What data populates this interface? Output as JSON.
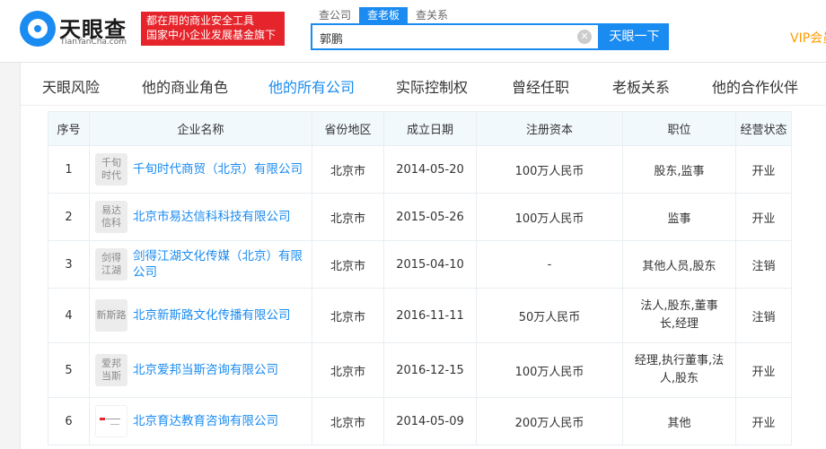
{
  "header": {
    "logo_cn": "天眼查",
    "logo_en": "TianYanCha.com",
    "slogan_line1": "都在用的商业安全工具",
    "slogan_line2": "国家中小企业发展基金旗下",
    "search_tabs": [
      "查公司",
      "查老板",
      "查关系"
    ],
    "search_value": "郭鹏",
    "search_button": "天眼一下",
    "vip": "VIP会员"
  },
  "tabs": [
    "天眼风险",
    "他的商业角色",
    "他的所有公司",
    "实际控制权",
    "曾经任职",
    "老板关系",
    "他的合作伙伴"
  ],
  "active_tab": 2,
  "table": {
    "headers": [
      "序号",
      "企业名称",
      "省份地区",
      "成立日期",
      "注册资本",
      "职位",
      "经营状态"
    ],
    "rows": [
      {
        "index": "1",
        "logo": "千旬\n时代",
        "name": "千旬时代商贸（北京）有限公司",
        "region": "北京市",
        "date": "2014-05-20",
        "capital": "100万人民币",
        "position": "股东,监事",
        "status": "开业"
      },
      {
        "index": "2",
        "logo": "易达\n信科",
        "name": "北京市易达信科科技有限公司",
        "region": "北京市",
        "date": "2015-05-26",
        "capital": "100万人民币",
        "position": "监事",
        "status": "开业"
      },
      {
        "index": "3",
        "logo": "剑得\n江湖",
        "name": "剑得江湖文化传媒（北京）有限公司",
        "region": "北京市",
        "date": "2015-04-10",
        "capital": "-",
        "position": "其他人员,股东",
        "status": "注销"
      },
      {
        "index": "4",
        "logo": "新斯路",
        "name": "北京新斯路文化传播有限公司",
        "region": "北京市",
        "date": "2016-11-11",
        "capital": "50万人民币",
        "position": "法人,股东,董事长,经理",
        "status": "注销"
      },
      {
        "index": "5",
        "logo": "爱邦\n当斯",
        "name": "北京爱邦当斯咨询有限公司",
        "region": "北京市",
        "date": "2016-12-15",
        "capital": "100万人民币",
        "position": "经理,执行董事,法人,股东",
        "status": "开业"
      },
      {
        "index": "6",
        "logo": "",
        "name": "北京育达教育咨询有限公司",
        "region": "北京市",
        "date": "2014-05-09",
        "capital": "200万人民币",
        "position": "其他",
        "status": "开业"
      }
    ]
  },
  "colors": {
    "accent": "#1a8bf0",
    "open": "#21b41b",
    "closed": "#e5242b",
    "vip": "#ff9c00"
  }
}
